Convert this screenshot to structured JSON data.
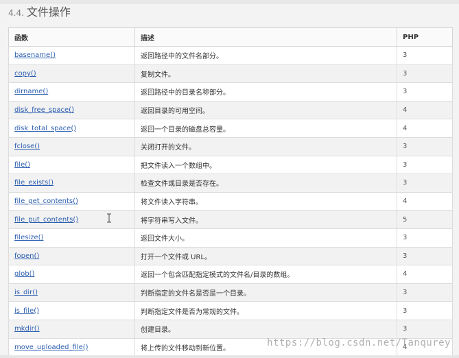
{
  "section": {
    "number": "4.4.",
    "title": "文件操作"
  },
  "table": {
    "headers": [
      "函数",
      "描述",
      "PHP"
    ],
    "rows": [
      {
        "func": "basename()",
        "desc": "返回路径中的文件名部分。",
        "php": "3"
      },
      {
        "func": "copy()",
        "desc": "复制文件。",
        "php": "3"
      },
      {
        "func": "dirname()",
        "desc": "返回路径中的目录名称部分。",
        "php": "3"
      },
      {
        "func": "disk_free_space()",
        "desc": "返回目录的可用空间。",
        "php": "4"
      },
      {
        "func": "disk_total_space()",
        "desc": "返回一个目录的磁盘总容量。",
        "php": "4"
      },
      {
        "func": "fclose()",
        "desc": "关闭打开的文件。",
        "php": "3"
      },
      {
        "func": "file()",
        "desc": "把文件读入一个数组中。",
        "php": "3"
      },
      {
        "func": "file_exists()",
        "desc": "检查文件或目录是否存在。",
        "php": "3"
      },
      {
        "func": "file_get_contents()",
        "desc": "将文件读入字符串。",
        "php": "4"
      },
      {
        "func": "file_put_contents()",
        "desc": "将字符串写入文件。",
        "php": "5"
      },
      {
        "func": "filesize()",
        "desc": "返回文件大小。",
        "php": "3"
      },
      {
        "func": "fopen()",
        "desc": "打开一个文件或 URL。",
        "php": "3"
      },
      {
        "func": "glob()",
        "desc": "返回一个包含匹配指定模式的文件名/目录的数组。",
        "php": "4"
      },
      {
        "func": "is_dir()",
        "desc": "判断指定的文件名是否是一个目录。",
        "php": "3"
      },
      {
        "func": "is_file()",
        "desc": "判断指定文件是否为常规的文件。",
        "php": "3"
      },
      {
        "func": "mkdir()",
        "desc": "创建目录。",
        "php": "3"
      },
      {
        "func": "move_uploaded_file()",
        "desc": "将上传的文件移动到新位置。",
        "php": "4"
      }
    ]
  },
  "watermark": "https://blog.csdn.net/Tanqurey"
}
